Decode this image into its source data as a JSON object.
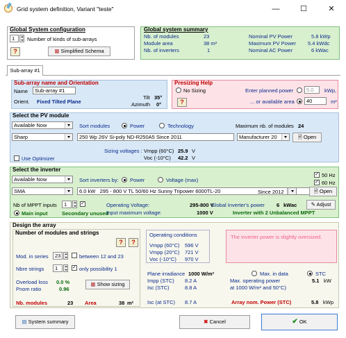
{
  "window": {
    "title": "Grid system definition, Variant  \"teste\"",
    "minimize": "—",
    "maximize": "☐",
    "close": "✕"
  },
  "global_config": {
    "title": "Global System configuration",
    "sub_arrays_count": "1",
    "sub_arrays_label": "Number of kinds of sub-arrays",
    "help": "?",
    "simplified_schema": "Simplified Schema"
  },
  "global_summary": {
    "title": "Global system summary",
    "rows": [
      {
        "label": "Nb. of modules",
        "value": "23",
        "label2": "Nominal PV Power",
        "value2": "5.8 kWp"
      },
      {
        "label": "Module area",
        "value": "38 m²",
        "label2": "Maximum PV Power",
        "value2": "5.4 kWdc"
      },
      {
        "label": "Nb. of inverters",
        "value": "1",
        "label2": "Nominal AC Power",
        "value2": "6 kWac"
      }
    ]
  },
  "tab": {
    "label": "Sub-array #1"
  },
  "subarray": {
    "title": "Sub-array name and Orientation",
    "name_label": "Name",
    "name_value": "Sub-array #1",
    "orient_label": "Orient.",
    "orient_value": "Fixed Tilted Plane",
    "tilt_label": "Tilt",
    "tilt_value": "35°",
    "azimuth_label": "Azimuth",
    "azimuth_value": "0°"
  },
  "presizing": {
    "title": "Presizing Help",
    "no_sizing": "No Sizing",
    "enter_power": "Enter planned power",
    "power_value": "5.0",
    "power_unit": "kWp,",
    "or_area": "... or available area",
    "area_value": "40",
    "area_unit": "m²",
    "help": "?"
  },
  "pv_module": {
    "title": "Select the PV module",
    "availability": "Available Now",
    "sort_label": "Sort modules",
    "sort_power": "Power",
    "sort_technology": "Technology",
    "max_modules_label": "Maximum nb. of modules",
    "max_modules_value": "24",
    "manufacturer": "Sharp",
    "module_desc": "250 Wp 26V   Si-poly    ND-R250A5                       Since 2011",
    "manufacturer_right": "Manufacturer 20",
    "open": "Open",
    "sizing_label": "Sizing voltages :",
    "vmpp_label": "Vmpp (60°C)",
    "vmpp_value": "25.9",
    "voc_label": "Voc  (-10°C)",
    "voc_value": "42.2",
    "volt_unit": "V",
    "use_optimizer": "Use Optimizer"
  },
  "inverter": {
    "title": "Select the inverter",
    "availability": "Available Now",
    "sort_label": "Sort inverters by:",
    "sort_power": "Power",
    "sort_voltage": "Voltage (max)",
    "hz50": "50 Hz",
    "hz60": "60 Hz",
    "manufacturer": "SMA",
    "power_value": "6.0 kW",
    "inverter_desc": "295 - 800 V  TL       50/60 Hz  Sunny Tripower 6000TL-20",
    "since": "Since 2012",
    "open": "Open",
    "mppt_label": "Nb of MPPT inputs",
    "mppt_value": "1",
    "op_voltage_label": "Operating Voltage:",
    "op_voltage_value": "295-800 V",
    "global_power_label": "Global Inverter's power",
    "global_power_value": "6",
    "global_power_unit": "kWac",
    "adjust": "Adjust",
    "main_input": "Main input",
    "secondary_unused": "Secondary unused",
    "input_max_label": "Input maximum voltage:",
    "input_max_value": "1000 V",
    "unbalanced_msg": "Inverter with  2 Unbalanced MPPT"
  },
  "design": {
    "title": "Design the array",
    "strings_title": "Number of modules and strings",
    "mod_series_label": "Mod. in series",
    "mod_series_value": "23",
    "between_label": "between 12 and 23",
    "nbre_strings_label": "Nbre strings",
    "nbre_strings_value": "1",
    "only_possibility": "only possibility 1",
    "overload_label": "Overload loss",
    "overload_value": "0.0 %",
    "pnom_label": "Pnom ratio",
    "pnom_value": "0.96",
    "show_sizing": "Show sizing",
    "nb_modules_label": "Nb. modules",
    "nb_modules_value": "23",
    "area_label": "Area",
    "area_value": "38",
    "area_unit": "m²",
    "help": "?",
    "conditions_title": "Operating conditions",
    "vmpp60_label": "Vmpp (60°C)",
    "vmpp60_value": "596 V",
    "vmpp20_label": "Vmpp (20°C)",
    "vmpp20_value": "721 V",
    "voc10_label": "Voc  (-10°C)",
    "voc10_value": "970 V",
    "oversized_msg": "The inverter power is slightly oversized.",
    "irradiance_label": "Plane irradiance",
    "irradiance_value": "1000 W/m²",
    "max_in_data": "Max. in data",
    "stc": "STC",
    "impp_label": "Impp (STC)",
    "impp_value": "8.2 A",
    "isc_label": "Isc  (STC)",
    "isc_value": "8.8 A",
    "max_op_power_label": "Max. operating power",
    "max_op_power_sub": "at 1000 W/m² and 50°C)",
    "max_op_power_value": "5.1",
    "max_op_power_unit": "kW",
    "isc_at_label": "Isc (at STC)",
    "isc_at_value": "8.7 A",
    "array_power_label": "Array nom. Power (STC)",
    "array_power_value": "5.8",
    "array_power_unit": "kWp"
  },
  "footer": {
    "system_summary": "System summary",
    "cancel": "Cancel",
    "ok": "OK"
  }
}
